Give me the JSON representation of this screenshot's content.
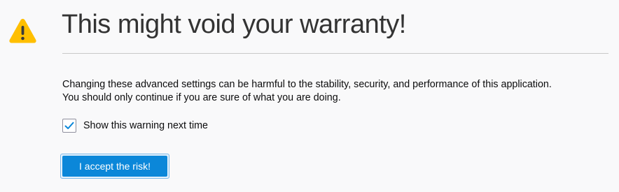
{
  "page": {
    "title": "This might void your warranty!",
    "warning_icon": "warning-triangle-icon",
    "message_line1": "Changing these advanced settings can be harmful to the stability, security, and performance of this application.",
    "message_line2": "You should only continue if you are sure of what you are doing."
  },
  "checkbox": {
    "label": "Show this warning next time",
    "checked": true
  },
  "button": {
    "label": "I accept the risk!"
  },
  "colors": {
    "warning": "#ffbf00",
    "accent": "#0b87d9",
    "background": "#f9f9fa"
  }
}
